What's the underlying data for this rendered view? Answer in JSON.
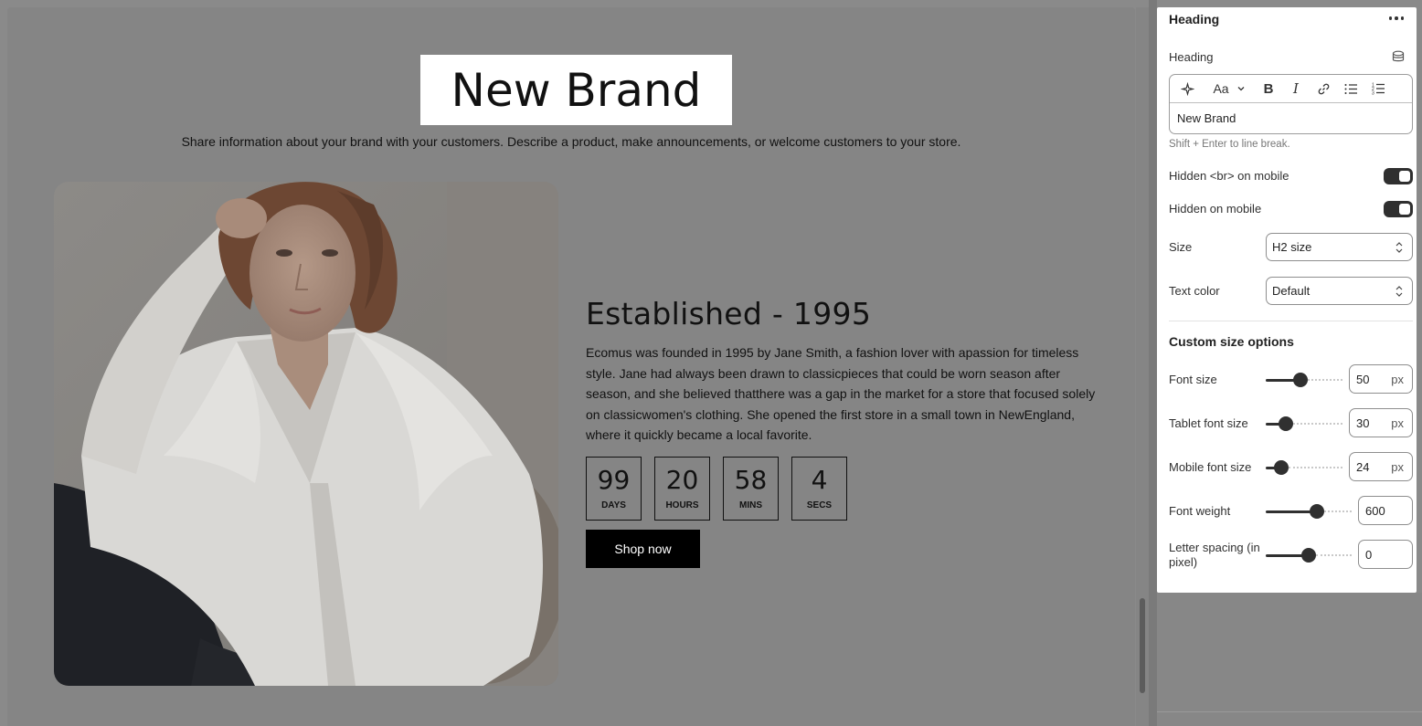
{
  "preview": {
    "heading": "New Brand",
    "subtext": "Share information about your brand with your customers. Describe a product, make announcements, or welcome customers to your store.",
    "story_title": "Established - 1995",
    "story_body": "Ecomus was founded in 1995 by Jane Smith, a fashion lover with apassion for timeless style. Jane had always been drawn to classicpieces that could be worn season after season, and she believed thatthere was a gap in the market for a store that focused solely on classicwomen's clothing. She opened the first store in a small town in NewEngland, where it quickly became a local favorite.",
    "countdown": [
      {
        "value": "99",
        "label": "DAYS"
      },
      {
        "value": "20",
        "label": "HOURS"
      },
      {
        "value": "58",
        "label": "MINS"
      },
      {
        "value": "4",
        "label": "SECS"
      }
    ],
    "cta_label": "Shop now"
  },
  "panel": {
    "title": "Heading",
    "heading_label": "Heading",
    "heading_value": "New Brand",
    "hint": "Shift + Enter to line break.",
    "hidden_br_label": "Hidden <br> on mobile",
    "hidden_br_on": true,
    "hidden_mobile_label": "Hidden on mobile",
    "hidden_mobile_on": true,
    "size_label": "Size",
    "size_value": "H2 size",
    "text_color_label": "Text color",
    "text_color_value": "Default",
    "custom_title": "Custom size options",
    "font_size": {
      "label": "Font size",
      "value": "50",
      "unit": "px"
    },
    "tablet_font_size": {
      "label": "Tablet font size",
      "value": "30",
      "unit": "px"
    },
    "mobile_font_size": {
      "label": "Mobile font size",
      "value": "24",
      "unit": "px"
    },
    "font_weight": {
      "label": "Font weight",
      "value": "600"
    },
    "letter_spacing": {
      "label": "Letter spacing (in pixel)",
      "value": "0"
    }
  },
  "colors": {
    "overlay": "#858585",
    "toggle_on": "#2f2f2f",
    "button": "#000000"
  }
}
